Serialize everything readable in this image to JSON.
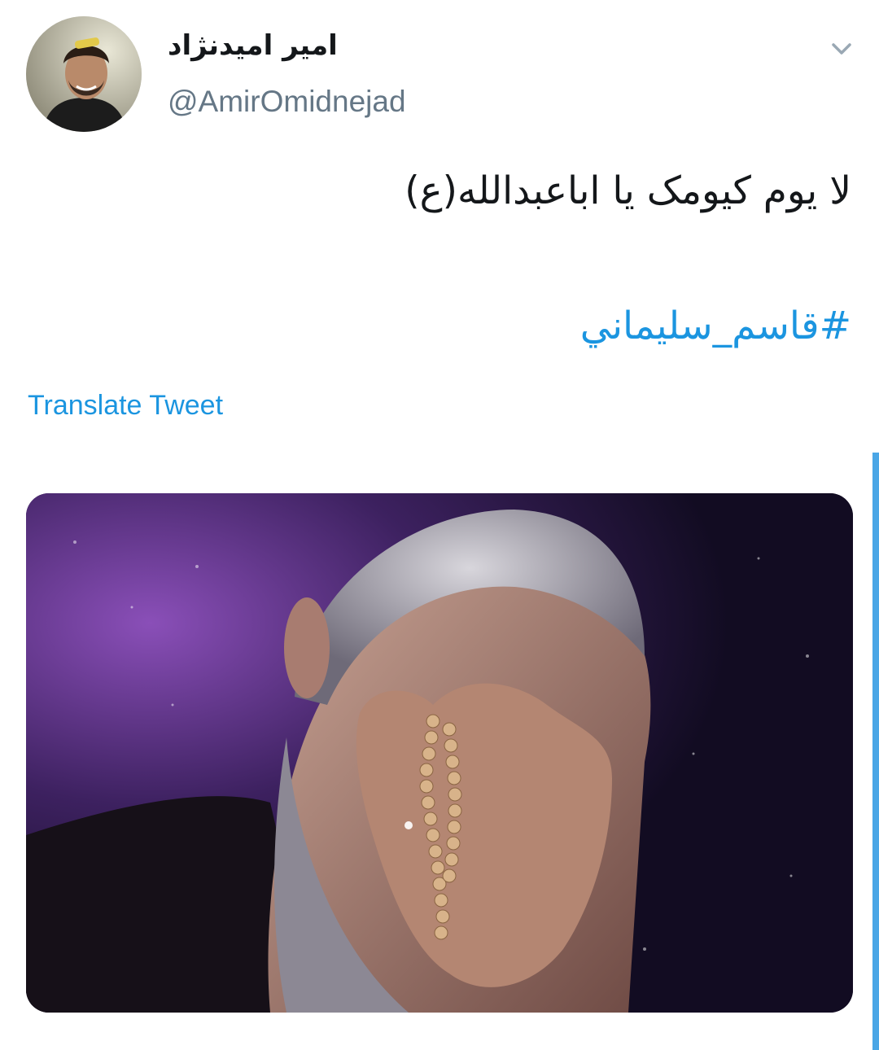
{
  "tweet": {
    "author": {
      "display_name": "امیر امیدنژاد",
      "handle": "@AmirOmidnejad"
    },
    "text": "لا یوم کیومک یا اباعبدالله(ع)",
    "hashtag": "#قاسم_سليماني",
    "translate_label": "Translate Tweet",
    "more_icon": "chevron-down-icon",
    "media_description_icon": "photo"
  },
  "colors": {
    "link": "#1b95e0",
    "handle": "#657786",
    "text": "#14171a",
    "scroll": "#4aa6e6"
  }
}
